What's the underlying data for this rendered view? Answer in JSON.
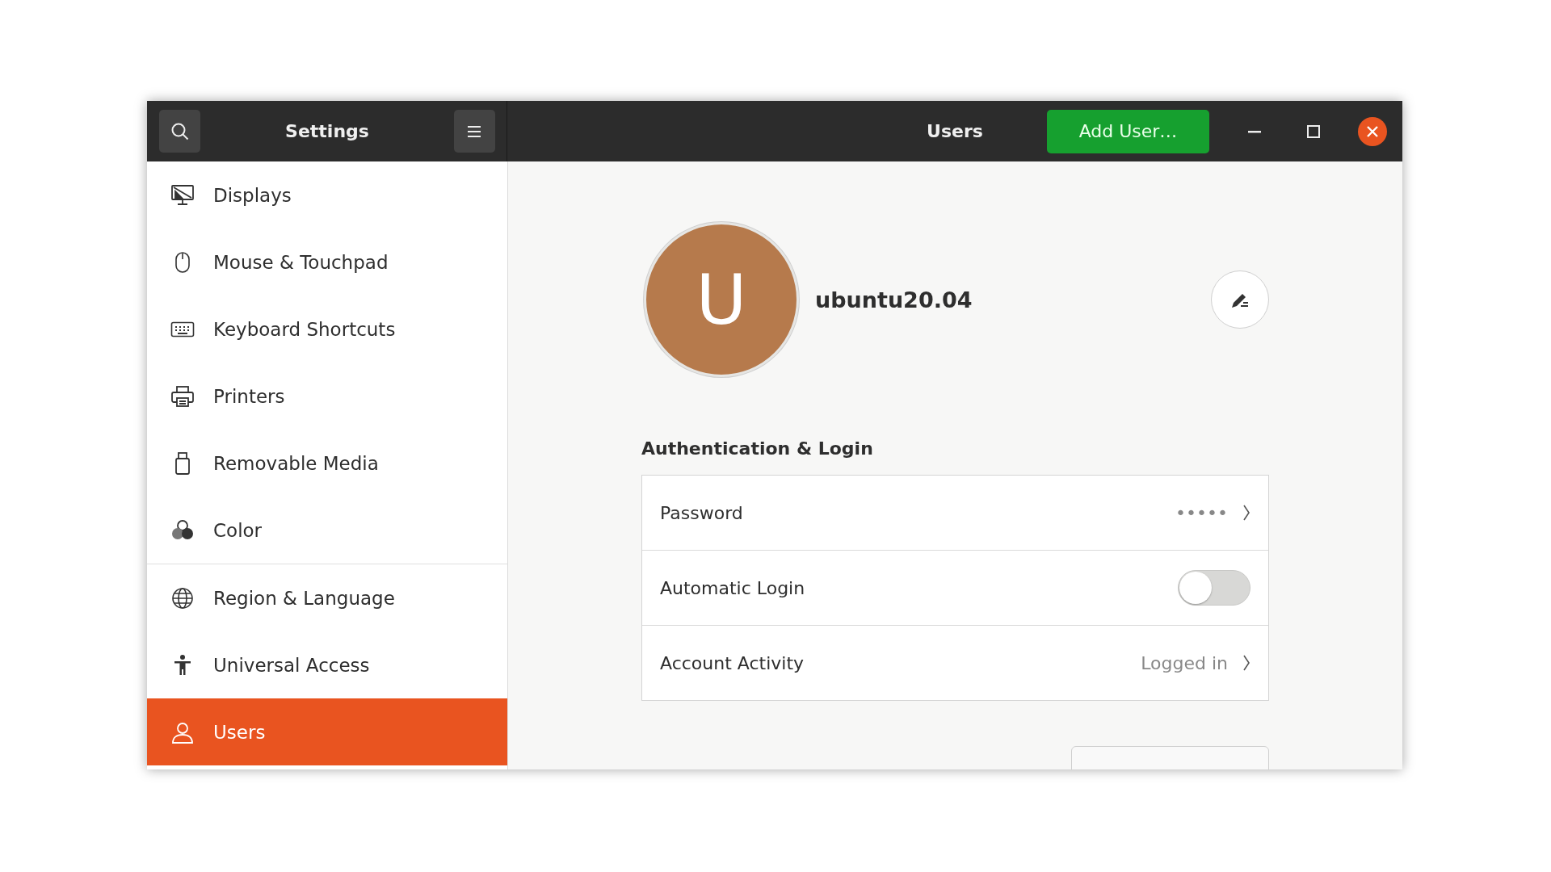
{
  "window": {
    "title": "Settings",
    "page_title": "Users",
    "add_button": "Add User…"
  },
  "sidebar": {
    "groups": [
      [
        {
          "label": "Displays",
          "selected": false
        },
        {
          "label": "Mouse & Touchpad",
          "selected": false
        },
        {
          "label": "Keyboard Shortcuts",
          "selected": false
        },
        {
          "label": "Printers",
          "selected": false
        },
        {
          "label": "Removable Media",
          "selected": false
        },
        {
          "label": "Color",
          "selected": false
        }
      ],
      [
        {
          "label": "Region & Language",
          "selected": false
        },
        {
          "label": "Universal Access",
          "selected": false
        },
        {
          "label": "Users",
          "selected": true
        }
      ]
    ]
  },
  "user": {
    "avatar_letter": "U",
    "name": "ubuntu20.04"
  },
  "section": {
    "title": "Authentication & Login",
    "rows": [
      {
        "kind": "link",
        "label": "Password",
        "value": "•••••"
      },
      {
        "kind": "switch",
        "label": "Automatic Login",
        "on": false
      },
      {
        "kind": "link",
        "label": "Account Activity",
        "value": "Logged in"
      }
    ]
  }
}
